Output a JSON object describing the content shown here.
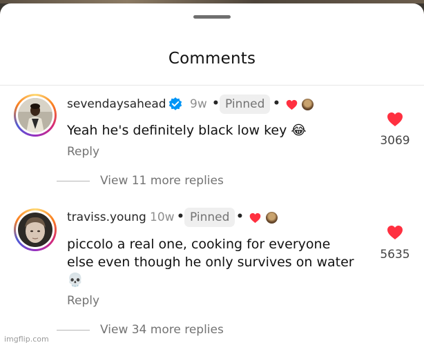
{
  "sheet": {
    "title": "Comments"
  },
  "comments": [
    {
      "username": "sevendaysahead",
      "verified": true,
      "age": "9w",
      "pinned_label": "Pinned",
      "separator": "•",
      "text": "Yeah he's definitely black low key 😂",
      "reply_label": "Reply",
      "likes": "3069",
      "view_replies": "View 11 more replies",
      "creator_liked": true
    },
    {
      "username": "traviss.young",
      "verified": false,
      "age": "10w",
      "pinned_label": "Pinned",
      "separator": "•",
      "text_line1": "piccolo a real one, cooking for everyone",
      "text_line2": "else even though he only survives on water",
      "text_line3": "💀",
      "reply_label": "Reply",
      "likes": "5635",
      "view_replies": "View 34 more replies",
      "creator_liked": true
    }
  ],
  "colors": {
    "like_red": "#ff3040",
    "verified_blue": "#0095f6",
    "pinned_bg": "#efefef",
    "muted_text": "#737373"
  },
  "icons": {
    "like": "heart-icon",
    "verified": "verified-badge-icon",
    "handle": "drag-handle"
  },
  "watermark": "imgflip.com"
}
